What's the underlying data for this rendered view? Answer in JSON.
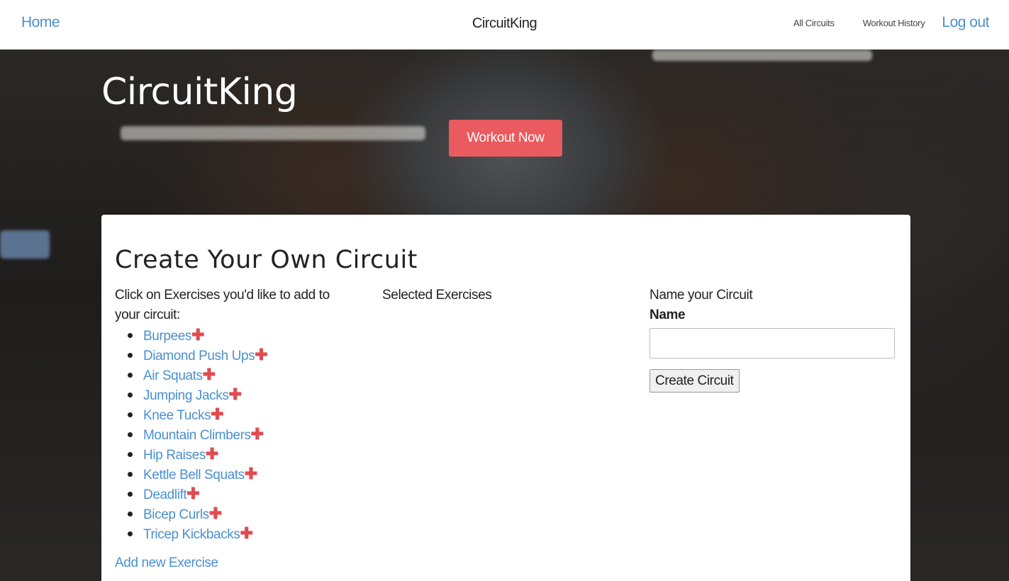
{
  "nav": {
    "home": "Home",
    "brand": "CircuitKing",
    "all_circuits": "All Circuits",
    "workout_history": "Workout History",
    "logout": "Log out"
  },
  "hero": {
    "title": "CircuitKing",
    "workout_button": "Workout Now"
  },
  "card": {
    "title": "Create Your Own Circuit",
    "instructions": "Click on Exercises you'd like to add to your circuit:",
    "selected_header": "Selected Exercises",
    "name_header": "Name your Circuit",
    "name_label": "Name",
    "name_value": "",
    "create_button": "Create Circuit",
    "add_new": "Add new Exercise",
    "add_icon": "plus-icon",
    "exercises": [
      {
        "label": "Burpees"
      },
      {
        "label": "Diamond Push Ups"
      },
      {
        "label": "Air Squats"
      },
      {
        "label": "Jumping Jacks"
      },
      {
        "label": "Knee Tucks"
      },
      {
        "label": "Mountain Climbers"
      },
      {
        "label": "Hip Raises"
      },
      {
        "label": "Kettle Bell Squats"
      },
      {
        "label": "Deadlift"
      },
      {
        "label": "Bicep Curls"
      },
      {
        "label": "Tricep Kickbacks"
      }
    ]
  },
  "colors": {
    "link": "#4a90d0",
    "accent": "#ea5a5e",
    "plus": "#e04b50"
  }
}
